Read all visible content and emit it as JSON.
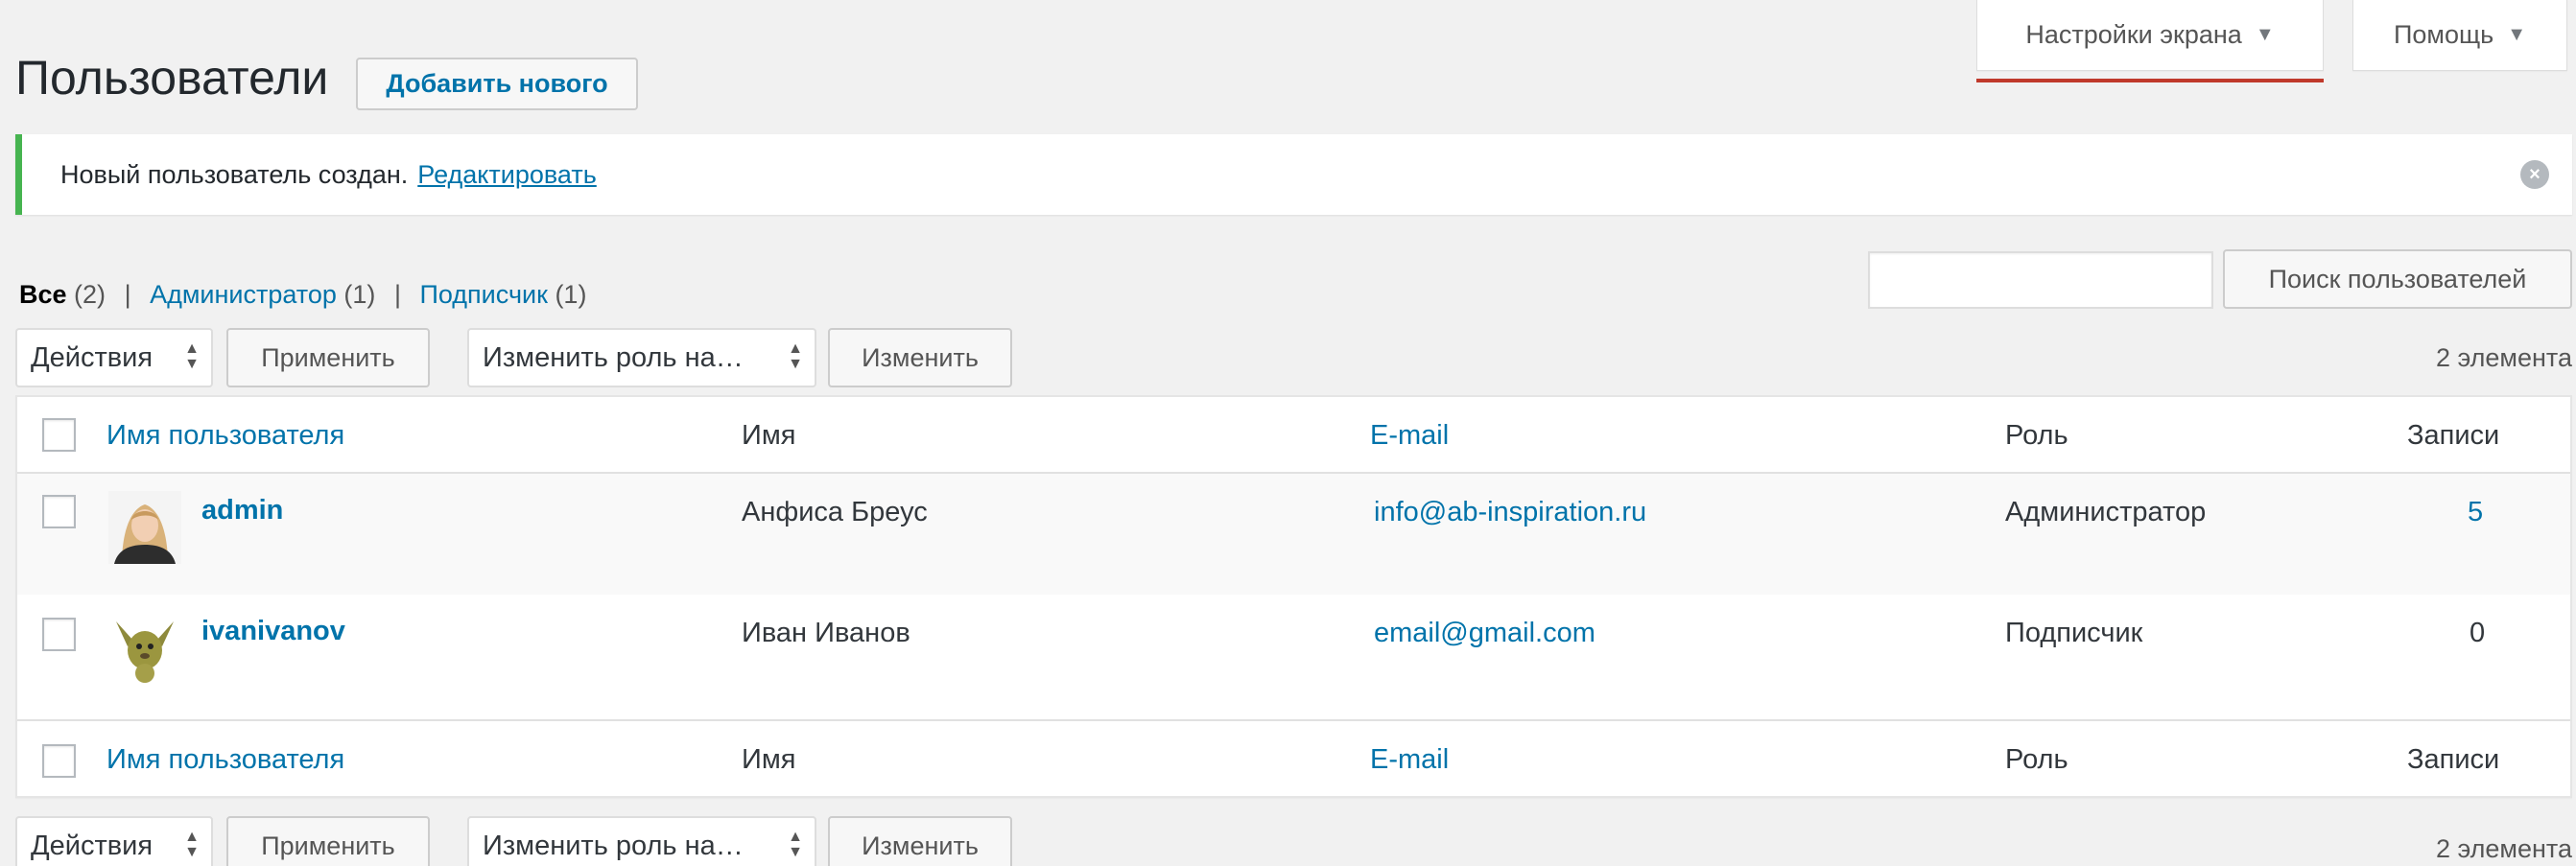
{
  "screen_options": {
    "label": "Настройки экрана",
    "arrow": "▼"
  },
  "help": {
    "label": "Помощь",
    "arrow": "▼"
  },
  "page": {
    "title": "Пользователи",
    "add_new": "Добавить нового"
  },
  "notice": {
    "text": "Новый пользователь создан.",
    "link": "Редактировать",
    "dismiss_icon": "dismiss-icon"
  },
  "views": [
    {
      "label": "Все",
      "count": "(2)"
    },
    {
      "label": "Администратор",
      "count": "(1)"
    },
    {
      "label": "Подписчик",
      "count": "(1)"
    }
  ],
  "search": {
    "value": "",
    "button": "Поиск пользователей"
  },
  "bulk": {
    "actions_label": "Действия",
    "apply": "Применить",
    "role_label": "Изменить роль на…",
    "change": "Изменить",
    "count": "2 элемента"
  },
  "columns": {
    "username": "Имя пользователя",
    "name": "Имя",
    "email": "E-mail",
    "role": "Роль",
    "posts": "Записи"
  },
  "users": [
    {
      "username": "admin",
      "name": "Анфиса Бреус",
      "email": "info@ab-inspiration.ru",
      "role": "Администратор",
      "posts": "5",
      "avatar": "woman-avatar"
    },
    {
      "username": "ivanivanov",
      "name": "Иван Иванов",
      "email": "email@gmail.com",
      "role": "Подписчик",
      "posts": "0",
      "avatar": "kangaroo-avatar"
    }
  ],
  "colors": {
    "link": "#0073aa",
    "notice_success": "#46b450",
    "underline_accent": "#c0392b"
  }
}
